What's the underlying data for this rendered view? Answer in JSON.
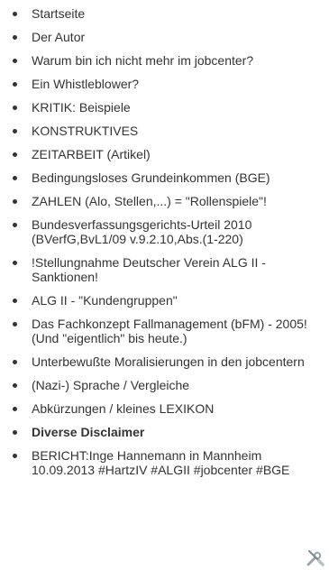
{
  "nav": {
    "items": [
      {
        "label": "Startseite",
        "bold": false
      },
      {
        "label": "Der Autor",
        "bold": false
      },
      {
        "label": "Warum bin ich nicht mehr im jobcenter?",
        "bold": false
      },
      {
        "label": "Ein Whistleblower?",
        "bold": false
      },
      {
        "label": "KRITIK: Beispiele",
        "bold": false
      },
      {
        "label": "KONSTRUKTIVES",
        "bold": false
      },
      {
        "label": "ZEITARBEIT (Artikel)",
        "bold": false
      },
      {
        "label": "Bedingungsloses Grundeinkommen (BGE)",
        "bold": false
      },
      {
        "label": "ZAHLEN (Alo, Stellen,...) = \"Rollenspiele\"!",
        "bold": false
      },
      {
        "label": "Bundesverfassungsgerichts-Urteil 2010 (BVerfG,BvL1/09 v.9.2.10,Abs.(1-220)",
        "bold": false
      },
      {
        "label": "!Stellungnahme Deutscher Verein ALG II - Sanktionen!",
        "bold": false
      },
      {
        "label": "ALG II - \"Kundengruppen\"",
        "bold": false
      },
      {
        "label": "Das Fachkonzept Fallmanagement (bFM) - 2005! (Und \"eigentlich\" bis heute.)",
        "bold": false
      },
      {
        "label": "Unterbewußte Moralisierungen in den jobcentern",
        "bold": false
      },
      {
        "label": "(Nazi-) Sprache / Vergleiche",
        "bold": false
      },
      {
        "label": "Abkürzungen / kleines LEXIKON",
        "bold": false
      },
      {
        "label": "Diverse Disclaimer",
        "bold": true
      },
      {
        "label": "BERICHT:Inge Hannemann in Mannheim 10.09.2013 #HartzIV #ALGII #jobcenter #BGE",
        "bold": false
      }
    ]
  },
  "icons": {
    "tools": "tools-icon"
  }
}
